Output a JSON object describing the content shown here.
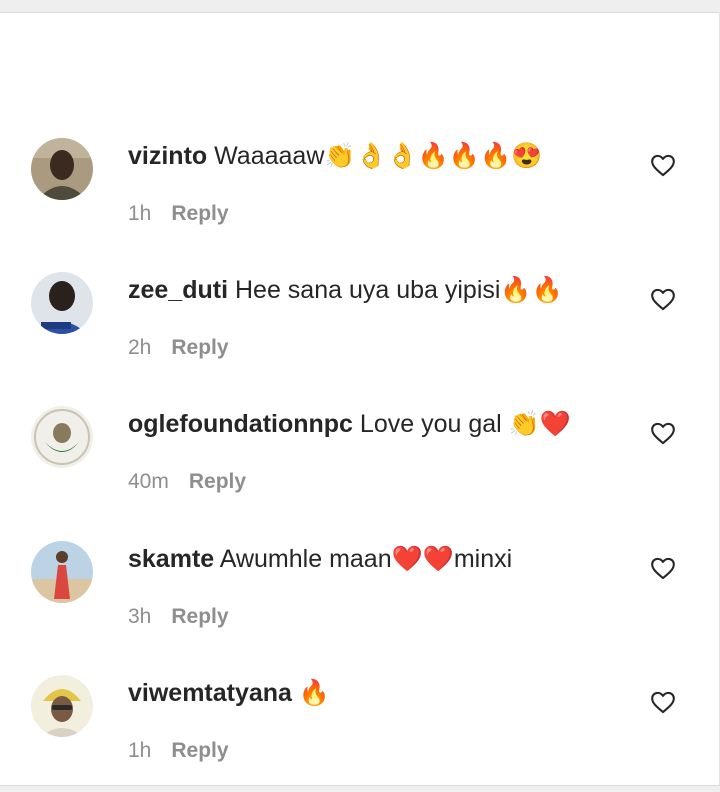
{
  "comments": [
    {
      "username": "vizinto",
      "text": "Waaaaaw👏👌👌🔥🔥🔥😍",
      "time": "1h",
      "reply": "Reply"
    },
    {
      "username": "zee_duti",
      "text": "Hee sana uya uba yipisi🔥🔥",
      "time": "2h",
      "reply": "Reply"
    },
    {
      "username": "oglefoundationnpc",
      "text": "Love you gal 👏❤️",
      "time": "40m",
      "reply": "Reply"
    },
    {
      "username": "skamte",
      "text": "Awumhle maan❤️❤️minxi",
      "time": "3h",
      "reply": "Reply"
    },
    {
      "username": "viwemtatyana",
      "text": "🔥",
      "time": "1h",
      "reply": "Reply"
    }
  ],
  "icons": {
    "like": "heart-outline-icon"
  }
}
